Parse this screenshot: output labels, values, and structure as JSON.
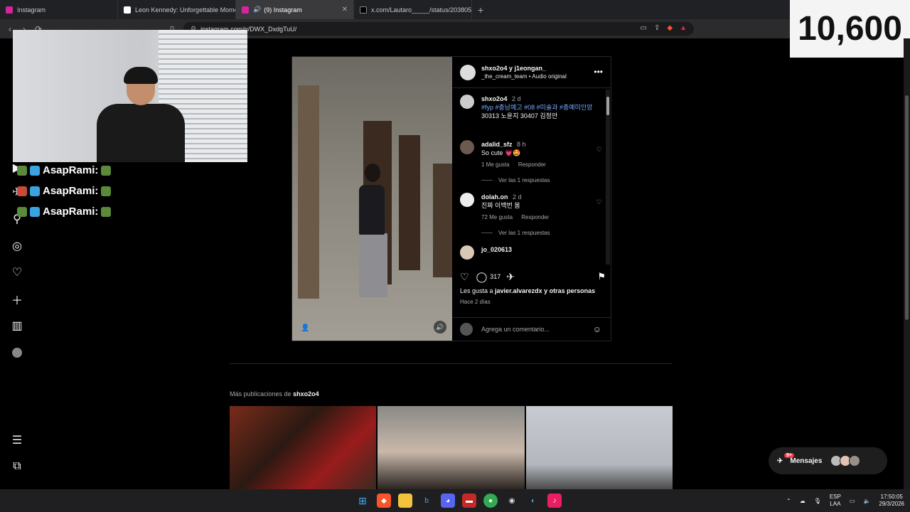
{
  "browser": {
    "tabs": [
      {
        "label": "Instagram",
        "icon": "instagram-icon",
        "color": "#d6249f"
      },
      {
        "label": "Leon Kennedy: Unforgettable Mome…",
        "icon": "tiktok-icon",
        "color": "#111111"
      },
      {
        "label": "(9) Instagram",
        "icon": "instagram-icon",
        "color": "#d6249f"
      },
      {
        "label": "x.com/Lautaro_____/status/2038055…",
        "icon": "x-icon",
        "color": "#000000"
      }
    ],
    "new_tab": "+",
    "url": "instagram.com/p/DWX_DxdgTuU/"
  },
  "stream_counter": "10,600",
  "chat_lines": [
    "AsapRami:",
    "AsapRami:",
    "AsapRami:"
  ],
  "post": {
    "header_names": "shxo2o4 y j1eongan_",
    "header_sub": "_the_cream_team • Audio original",
    "caption": {
      "user": "shxo2o4",
      "time": "2 d",
      "tags": "#fyp #충남예고 #08 #미술과 #충예미인앙",
      "text": "30313 노윤지 30407 김정안"
    },
    "comments": [
      {
        "user": "adalid_sfz",
        "time": "8 h",
        "text": "So cute 💗🤩",
        "likes": "1 Me gusta",
        "reply": "Responder",
        "replies": "Ver las 1 respuestas"
      },
      {
        "user": "dolah.on",
        "time": "2 d",
        "text": "진짜 이백번 봄",
        "likes": "72 Me gusta",
        "reply": "Responder",
        "replies": "Ver las 1 respuestas"
      },
      {
        "user": "jo_020613"
      }
    ],
    "comment_count": "317",
    "likes_text_pre": "Les gusta a ",
    "likes_user": "javier.alvarezdx",
    "likes_text_post": " y otras personas",
    "ago": "Hace 2 días",
    "add_comment_placeholder": "Agrega un comentario..."
  },
  "more_posts": {
    "label": "Más publicaciones de ",
    "user": "shxo2o4"
  },
  "messages": {
    "label": "Mensajes",
    "badge": "9+"
  },
  "taskbar": {
    "lang_top": "ESP",
    "lang_bottom": "LAA",
    "time": "17:50:05",
    "date": "29/3/2026"
  }
}
